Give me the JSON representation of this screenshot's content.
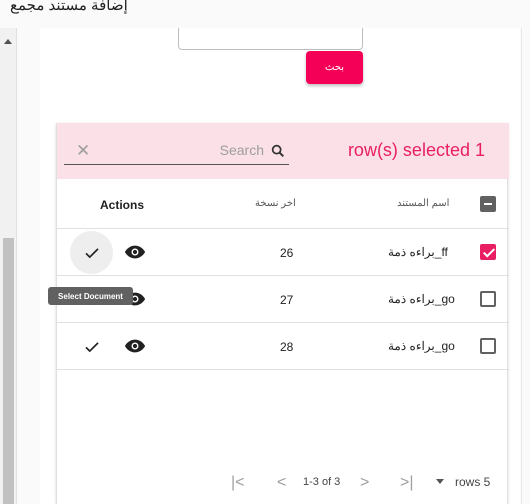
{
  "dialog": {
    "title": "إضافة مستند مجمع"
  },
  "search_button": {
    "label": "بحث"
  },
  "toolbar": {
    "selected_text": "row(s) selected 1",
    "search_placeholder": "Search",
    "clear_icon": "close-icon",
    "search_icon": "search-icon"
  },
  "table": {
    "headers": {
      "actions": "Actions",
      "last_copy": "اخر نسخة",
      "doc_name": "اسم المستند"
    },
    "rows": [
      {
        "copy": "26",
        "name": "براءه ذمة_ff",
        "selected": true
      },
      {
        "copy": "27",
        "name": "براءه ذمة_go",
        "selected": false
      },
      {
        "copy": "28",
        "name": "براءه ذمة_go",
        "selected": false
      }
    ]
  },
  "tooltip": {
    "text": "Select Document"
  },
  "pagination": {
    "rows_label": "rows 5",
    "range": "1-3 of 3"
  },
  "colors": {
    "accent": "#e91e63",
    "button": "#f50057",
    "toolbar_bg": "#fbe0e8"
  }
}
